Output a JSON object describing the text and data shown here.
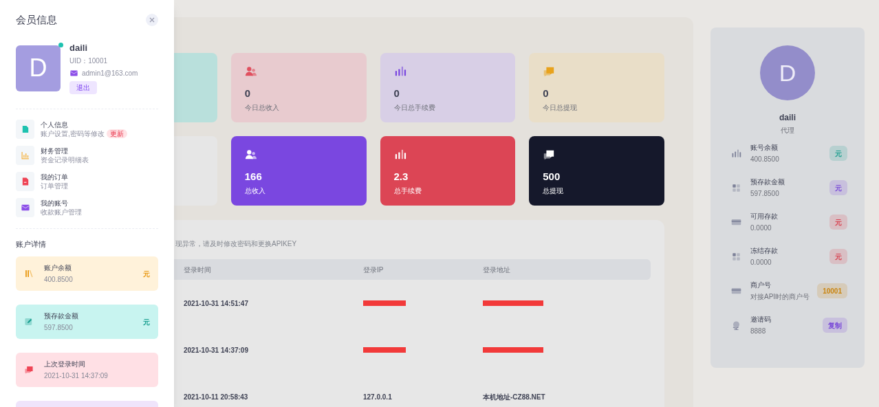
{
  "drawer": {
    "title": "会员信息",
    "profile": {
      "avatar_letter": "D",
      "online": true,
      "name": "daili",
      "uid": "UID：10001",
      "email": "admin1@163.com",
      "logout": "退出"
    },
    "menu": [
      {
        "title": "个人信息",
        "subtitle": "账户设置,密码等修改",
        "badge": "更新"
      },
      {
        "title": "财务管理",
        "subtitle": "资金记录明细表"
      },
      {
        "title": "我的订单",
        "subtitle": "订单管理"
      },
      {
        "title": "我的账号",
        "subtitle": "收款账户管理"
      }
    ],
    "details_title": "账户详情",
    "details": [
      {
        "color": "#fff2da",
        "title": "账户余额",
        "value": "400.8500",
        "unit": "元"
      },
      {
        "color": "#c8f4f0",
        "title": "预存款金额",
        "value": "597.8500",
        "unit": "元"
      },
      {
        "color": "#ffe0e5",
        "title": "上次登录时间",
        "value": "2021-10-31 14:37:09"
      },
      {
        "color": "#efe4fb"
      }
    ]
  },
  "stats": [
    {
      "kind": "light",
      "color": "#b9e0dc"
    },
    {
      "kind": "light",
      "color": "#e8cbcf",
      "value": "0",
      "label": "今日总收入"
    },
    {
      "kind": "light",
      "color": "#d8cfe6",
      "value": "0",
      "label": "今日总手续费"
    },
    {
      "kind": "light",
      "color": "#e9dec8",
      "value": "0",
      "label": "今日总提现"
    },
    {
      "kind": "light",
      "color": "#e6e6e6"
    },
    {
      "kind": "solid",
      "color": "#7a47e0",
      "value": "166",
      "label": "总收入"
    },
    {
      "kind": "solid",
      "color": "#dc4555",
      "value": "2.3",
      "label": "总手续费"
    },
    {
      "kind": "solid",
      "color": "#15182b",
      "value": "500",
      "label": "总提现"
    }
  ],
  "login_log": {
    "note": "现异常，请及时修改密码和更换APIKEY",
    "columns": [
      "登录时间",
      "登录IP",
      "登录地址"
    ],
    "rows": [
      [
        {
          "kind": "text",
          "text": "2021-10-31 14:51:47"
        },
        {
          "kind": "redacted"
        },
        {
          "kind": "redacted"
        }
      ],
      [
        {
          "kind": "text",
          "text": "2021-10-31 14:37:09"
        },
        {
          "kind": "redacted"
        },
        {
          "kind": "redacted"
        }
      ],
      [
        {
          "kind": "text",
          "text": "2021-10-11 20:58:43"
        },
        {
          "kind": "text",
          "text": "127.0.0.1"
        },
        {
          "kind": "text",
          "text": "本机地址-CZ88.NET"
        }
      ]
    ]
  },
  "profile_card": {
    "avatar_letter": "D",
    "name": "daili",
    "role": "代理",
    "items": [
      {
        "title": "账号余额",
        "value": "400.8500",
        "badge": "元",
        "color": "#1a9e8e"
      },
      {
        "title": "预存款金额",
        "value": "597.8500",
        "badge": "元",
        "color": "#7a4ad8"
      },
      {
        "title": "可用存款",
        "value": "0.0000",
        "badge": "元",
        "color": "#d8404f"
      },
      {
        "title": "冻结存款",
        "value": "0.0000",
        "badge": "元",
        "color": "#d8404f"
      },
      {
        "title": "商户号",
        "value": "对接API时的商户号",
        "badge": "10001",
        "color": "#c98510"
      },
      {
        "title": "邀请码",
        "value": "8888",
        "badge": "复制",
        "color": "#7a4ad8"
      }
    ]
  }
}
